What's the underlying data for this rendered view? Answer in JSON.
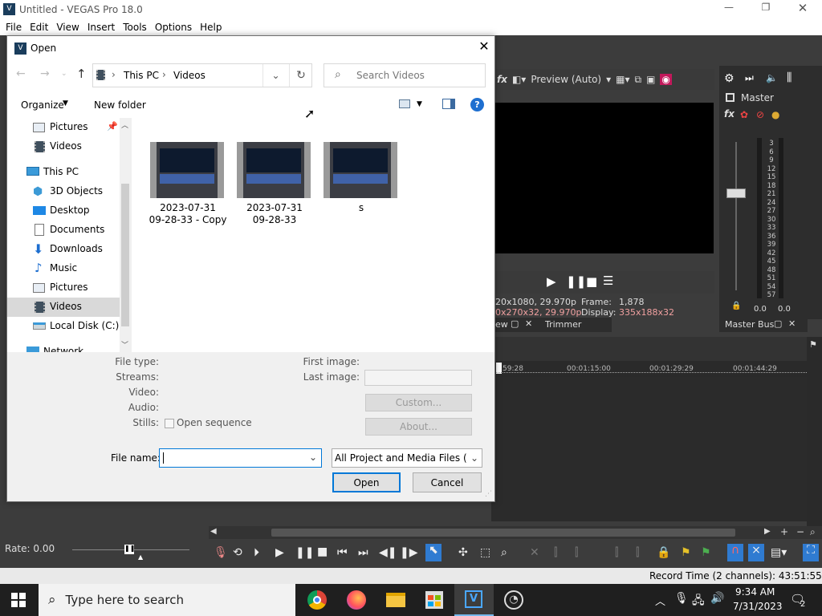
{
  "app": {
    "title": "Untitled - VEGAS Pro 18.0",
    "menu": [
      "File",
      "Edit",
      "View",
      "Insert",
      "Tools",
      "Options",
      "Help"
    ],
    "preview": {
      "quality": "Preview (Auto)",
      "info_line1_left": "20x1080, 29.970p",
      "info_line2_left": "0x270x32, 29.970p",
      "frame_label": "Frame:",
      "frame_value": "1,878",
      "display_label": "Display:",
      "display_value": "335x188x32",
      "tab_partial": "ew",
      "tab_trimmer": "Trimmer"
    },
    "mixer": {
      "title": "Master",
      "scale": [
        "3",
        "6",
        "9",
        "12",
        "15",
        "18",
        "21",
        "24",
        "27",
        "30",
        "33",
        "36",
        "39",
        "42",
        "45",
        "48",
        "51",
        "54",
        "57"
      ],
      "value_left": "0.0",
      "value_right": "0.0",
      "tab": "Master Bus"
    },
    "timeline": {
      "ruler": [
        "59:28",
        "00:01:15:00",
        "00:01:29:29",
        "00:01:44:29"
      ]
    },
    "rate_label": "Rate: 0.00",
    "status": "Record Time (2 channels): 43:51:55"
  },
  "dialog": {
    "title": "Open",
    "breadcrumb": [
      "This PC",
      "Videos"
    ],
    "search_placeholder": "Search Videos",
    "organize_label": "Organize",
    "new_folder_label": "New folder",
    "nav_items": [
      {
        "label": "Pictures",
        "icon": "pictures-icon",
        "pinned": true
      },
      {
        "label": "Videos",
        "icon": "videos-icon"
      },
      {
        "label": "This PC",
        "icon": "this-pc-icon"
      },
      {
        "label": "3D Objects",
        "icon": "3d-objects-icon"
      },
      {
        "label": "Desktop",
        "icon": "desktop-icon"
      },
      {
        "label": "Documents",
        "icon": "documents-icon"
      },
      {
        "label": "Downloads",
        "icon": "downloads-icon"
      },
      {
        "label": "Music",
        "icon": "music-icon"
      },
      {
        "label": "Pictures",
        "icon": "pictures-icon"
      },
      {
        "label": "Videos",
        "icon": "videos-icon",
        "selected": true
      },
      {
        "label": "Local Disk (C:)",
        "icon": "local-disk-icon"
      },
      {
        "label": "Network",
        "icon": "network-icon"
      }
    ],
    "files": [
      {
        "name": "2023-07-31\n09-28-33 - Copy"
      },
      {
        "name": "2023-07-31\n09-28-33"
      },
      {
        "name": "s"
      }
    ],
    "details": {
      "file_type_label": "File type:",
      "streams_label": "Streams:",
      "video_label": "Video:",
      "audio_label": "Audio:",
      "stills_label": "Stills:",
      "open_sequence_label": "Open sequence",
      "first_image_label": "First image:",
      "last_image_label": "Last image:",
      "custom_label": "Custom...",
      "about_label": "About..."
    },
    "file_name_label": "File name:",
    "file_name_value": "",
    "filter_value": "All Project and Media Files (*.ve",
    "open_label": "Open",
    "cancel_label": "Cancel"
  },
  "taskbar": {
    "search_placeholder": "Type here to search",
    "time": "9:34 AM",
    "date": "7/31/2023",
    "notification_count": "2"
  },
  "colors": {
    "accent": "#0078d7",
    "selected_nav": "#cce8ff",
    "vegas_dark": "#3c3c3c"
  }
}
